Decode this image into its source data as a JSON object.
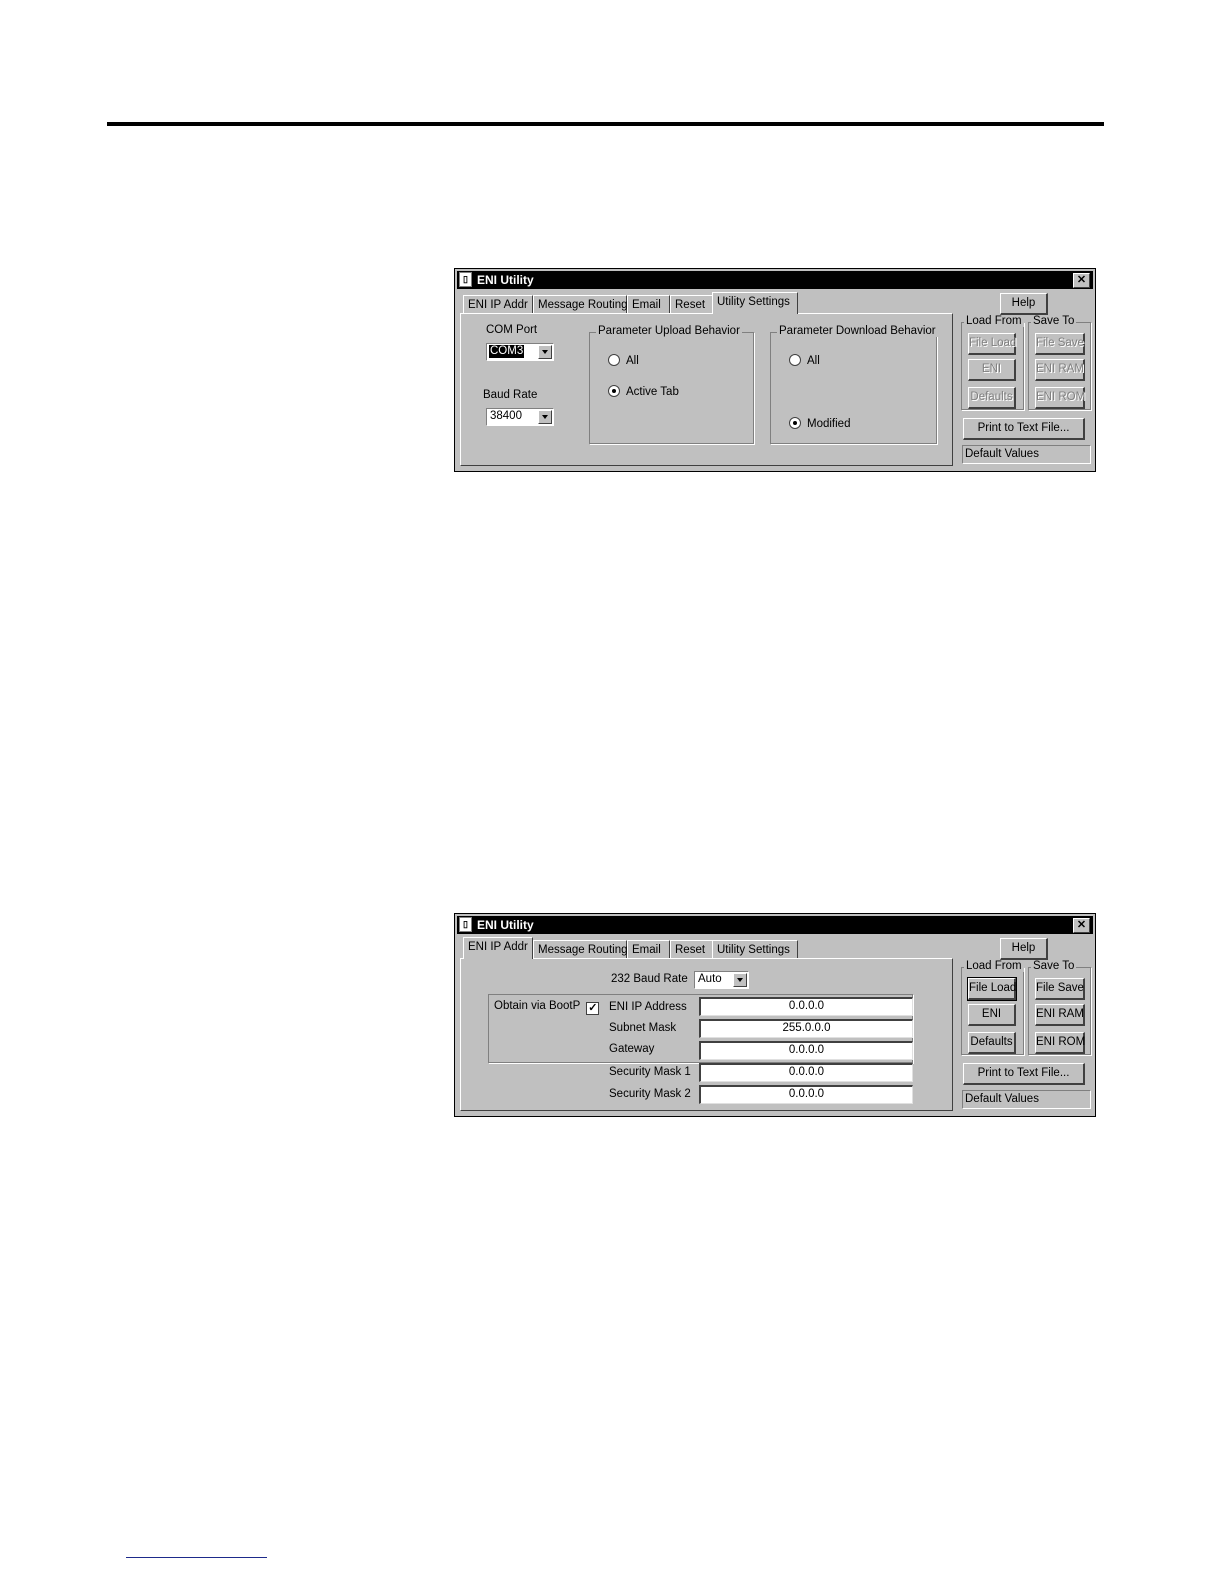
{
  "window_title": "ENI Utility",
  "tabs": [
    "ENI IP Addr",
    "Message Routing",
    "Email",
    "Reset",
    "Utility Settings"
  ],
  "side": {
    "help": "Help",
    "load_from": "Load From",
    "save_to": "Save To",
    "file_load": "File Load",
    "file_save": "File Save",
    "eni": "ENI",
    "eni_ram": "ENI RAM",
    "defaults": "Defaults",
    "eni_rom": "ENI ROM",
    "print": "Print to Text File...",
    "status": "Default Values"
  },
  "utility_settings": {
    "com_port_label": "COM Port",
    "com_port_value": "COM3",
    "baud_rate_label": "Baud Rate",
    "baud_rate_value": "38400",
    "upload_group": "Parameter Upload Behavior",
    "upload_all": "All",
    "upload_active_tab": "Active Tab",
    "upload_selected": "Active Tab",
    "download_group": "Parameter Download Behavior",
    "download_all": "All",
    "download_modified": "Modified",
    "download_selected": "Modified"
  },
  "ip_addr": {
    "baud_label": "232 Baud Rate",
    "baud_value": "Auto",
    "bootp_label": "Obtain via BootP",
    "bootp_checked": true,
    "check_glyph": "✓",
    "fields": [
      {
        "label": "ENI IP Address",
        "value": "0.0.0.0"
      },
      {
        "label": "Subnet Mask",
        "value": "255.0.0.0"
      },
      {
        "label": "Gateway",
        "value": "0.0.0.0"
      },
      {
        "label": "Security Mask 1",
        "value": "0.0.0.0"
      },
      {
        "label": "Security Mask 2",
        "value": "0.0.0.0"
      }
    ]
  }
}
